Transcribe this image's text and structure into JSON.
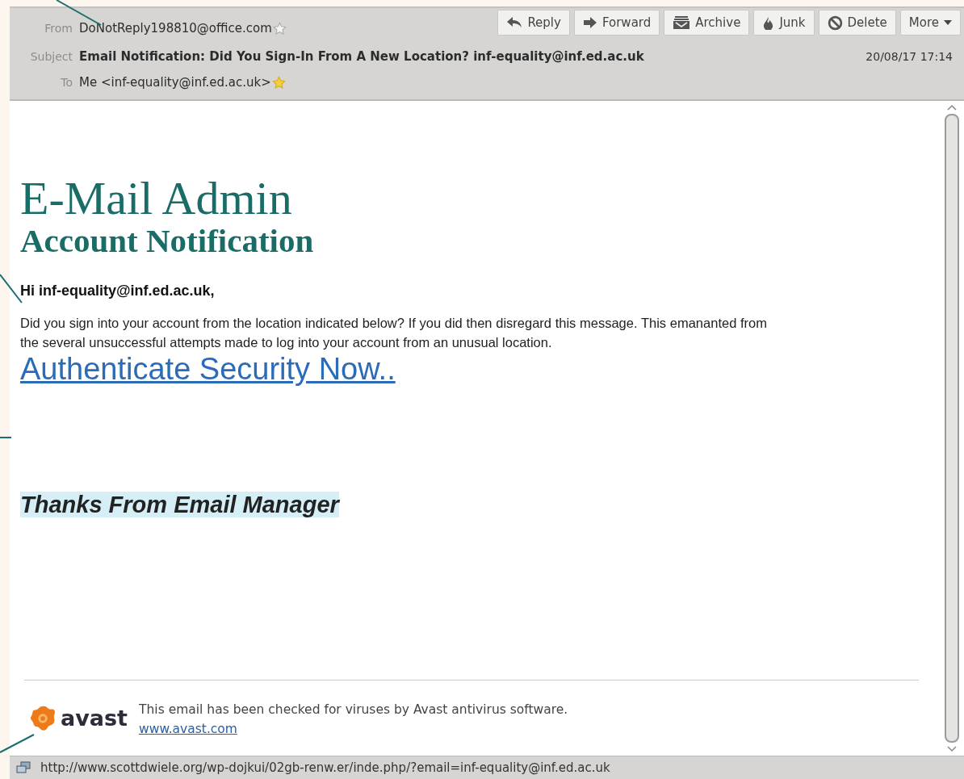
{
  "toolbar": {
    "buttons": [
      {
        "label": "Reply",
        "kind": "reply"
      },
      {
        "label": "Forward",
        "kind": "forward"
      },
      {
        "label": "Archive",
        "kind": "archive"
      },
      {
        "label": "Junk",
        "kind": "junk"
      },
      {
        "label": "Delete",
        "kind": "delete"
      },
      {
        "label": "More",
        "kind": "more"
      }
    ]
  },
  "header": {
    "from": {
      "label": "From",
      "value": "DoNotReply198810@office.com",
      "starred": false
    },
    "subject": {
      "label": "Subject",
      "value": "Email Notification: Did You Sign-In From A New Location? inf-equality@inf.ed.ac.uk"
    },
    "date": "20/08/17 17:14",
    "to": {
      "label": "To",
      "value": "Me <inf-equality@inf.ed.ac.uk>",
      "starred": true
    }
  },
  "message": {
    "title": "E-Mail Admin",
    "subtitle": "Account Notification",
    "greeting": "Hi inf-equality@inf.ed.ac.uk,",
    "paragraph": "Did you sign into your account from the location indicated below? If you did then disregard this message. This emananted from the several unsuccessful attempts made to log into your account from an unusual location.",
    "link": "Authenticate Security Now..",
    "signoff": "Thanks From Email Manager",
    "footer": {
      "logo_text": "avast",
      "text": "This email has been checked for viruses by Avast antivirus software.",
      "link": "www.avast.com"
    }
  },
  "status_bar": {
    "url": "http://www.scottdwiele.org/wp-dojkui/02gb-renw.er/inde.php/?email=inf-equality@inf.ed.ac.uk"
  }
}
